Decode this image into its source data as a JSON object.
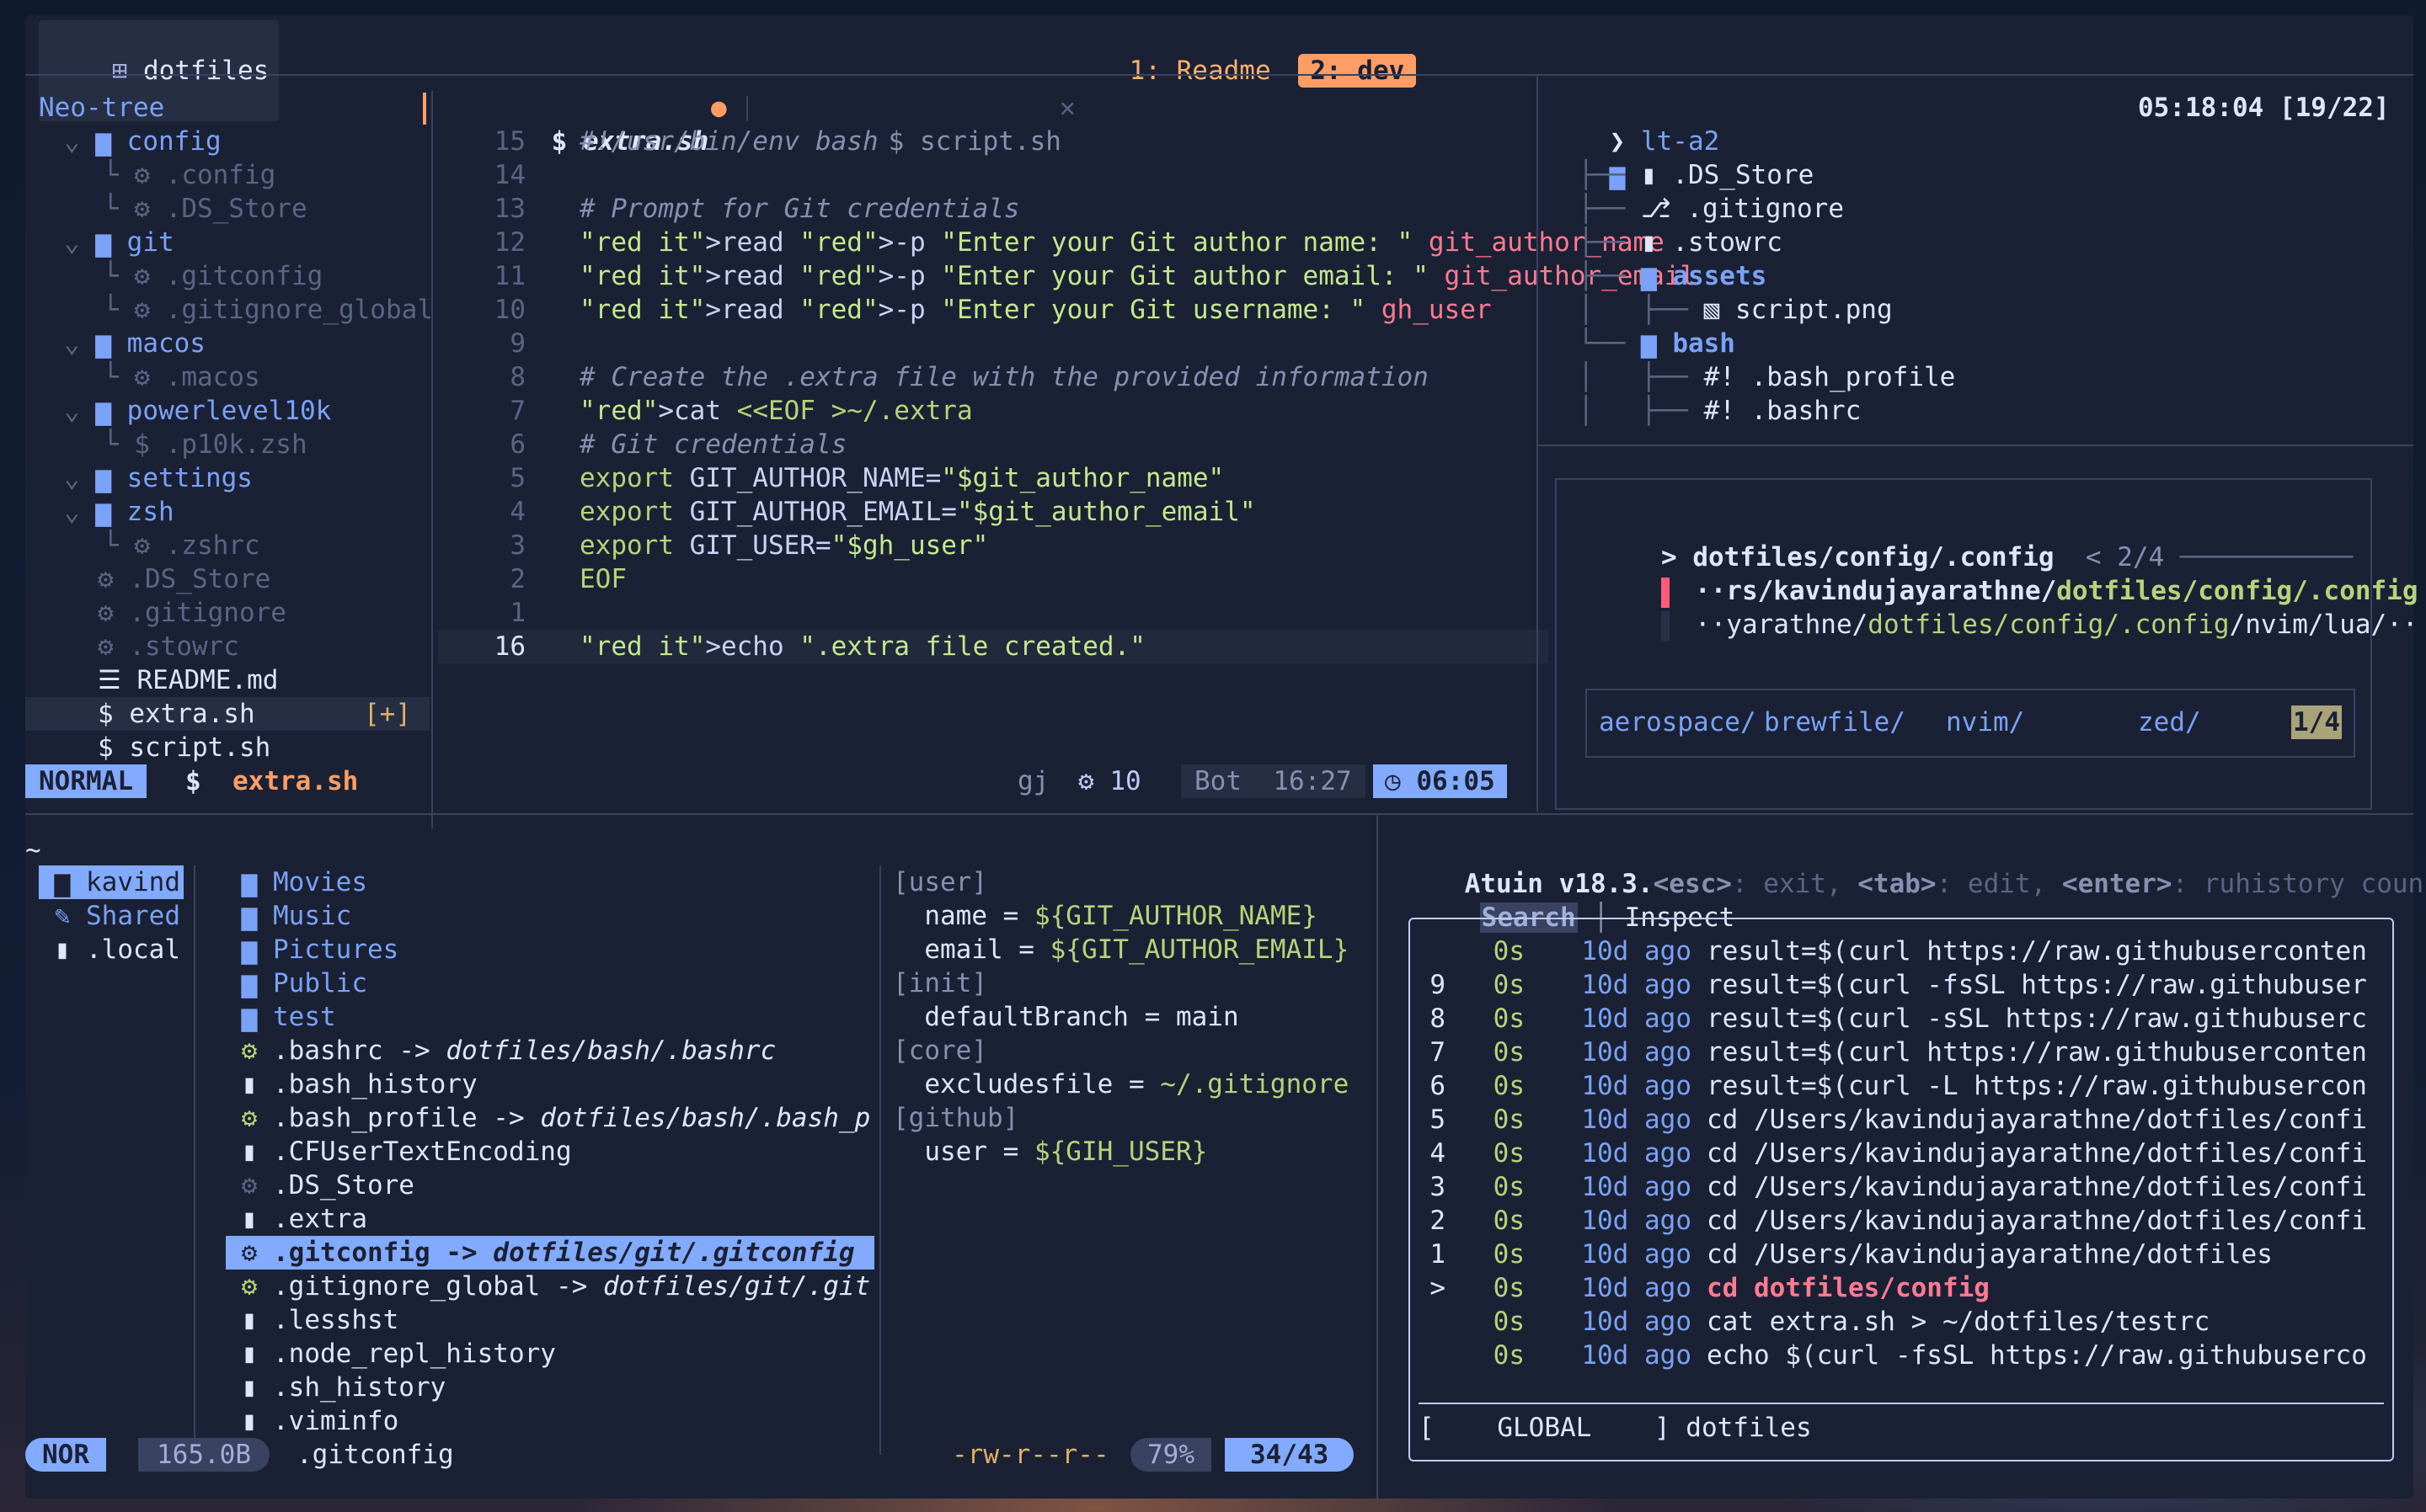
{
  "tmux": {
    "session": "dotfiles",
    "windows": [
      "1: Readme",
      "2: dev"
    ]
  },
  "neotree": {
    "title": "Neo-tree",
    "items": [
      {
        "t": "config",
        "k": "dir",
        "d": 0
      },
      {
        "t": ".config",
        "k": "dim",
        "d": 1
      },
      {
        "t": ".DS_Store",
        "k": "dim",
        "d": 1
      },
      {
        "t": "git",
        "k": "dir",
        "d": 0
      },
      {
        "t": ".gitconfig",
        "k": "dim",
        "d": 1
      },
      {
        "t": ".gitignore_global",
        "k": "dim",
        "d": 1
      },
      {
        "t": "macos",
        "k": "dir",
        "d": 0
      },
      {
        "t": ".macos",
        "k": "dim",
        "d": 1
      },
      {
        "t": "powerlevel10k",
        "k": "dir",
        "d": 0
      },
      {
        "t": ".p10k.zsh",
        "k": "dim",
        "d": 1
      },
      {
        "t": "settings",
        "k": "dir",
        "d": 0
      },
      {
        "t": "zsh",
        "k": "dir",
        "d": 0
      },
      {
        "t": ".zshrc",
        "k": "dim",
        "d": 1
      },
      {
        "t": ".DS_Store",
        "k": "dim",
        "d": 0
      },
      {
        "t": ".gitignore",
        "k": "dim",
        "d": 0
      },
      {
        "t": ".stowrc",
        "k": "dim",
        "d": 0
      },
      {
        "t": "README.md",
        "k": "file",
        "d": 0
      },
      {
        "t": "extra.sh",
        "k": "file",
        "d": 0,
        "mark": "[+]"
      },
      {
        "t": "script.sh",
        "k": "file",
        "d": 0
      }
    ]
  },
  "editor": {
    "tabs": [
      {
        "name": "extra.sh",
        "active": true,
        "mark": "●"
      },
      {
        "name": "script.sh",
        "active": false,
        "mark": "✕"
      }
    ],
    "lines": [
      {
        "n": "15",
        "code": "#!/usr/bin/env bash"
      },
      {
        "n": "14",
        "code": ""
      },
      {
        "n": "13",
        "code": "# Prompt for Git credentials"
      },
      {
        "n": "12",
        "code": "read -p \"Enter your Git author name: \" git_author_name"
      },
      {
        "n": "11",
        "code": "read -p \"Enter your Git author email: \" git_author_email"
      },
      {
        "n": "10",
        "code": "read -p \"Enter your Git username: \" gh_user"
      },
      {
        "n": "9",
        "code": ""
      },
      {
        "n": "8",
        "code": "# Create the .extra file with the provided information"
      },
      {
        "n": "7",
        "code": "cat <<EOF >~/.extra"
      },
      {
        "n": "6",
        "code": "# Git credentials"
      },
      {
        "n": "5",
        "code": "export GIT_AUTHOR_NAME=\"$git_author_name\""
      },
      {
        "n": "4",
        "code": "export GIT_AUTHOR_EMAIL=\"$git_author_email\""
      },
      {
        "n": "3",
        "code": "export GIT_USER=\"$gh_user\""
      },
      {
        "n": "2",
        "code": "EOF"
      },
      {
        "n": "1",
        "code": ""
      },
      {
        "n": "16",
        "code": "echo \".extra file created.\""
      }
    ],
    "status": {
      "mode": "NORMAL",
      "file": "extra.sh",
      "keys": "gj",
      "diag": "10",
      "pos": "Bot",
      "cursor": "16:27",
      "clock": "06:05"
    }
  },
  "broot": {
    "prompt": "lt-a2",
    "time": "05:18:04 [19/22]",
    "root": ".",
    "items": [
      {
        "t": ".DS_Store",
        "d": 1
      },
      {
        "t": ".gitignore",
        "d": 1
      },
      {
        "t": ".stowrc",
        "d": 1
      },
      {
        "t": "assets",
        "d": 1,
        "dir": true
      },
      {
        "t": "script.png",
        "d": 2
      },
      {
        "t": "bash",
        "d": 1,
        "dir": true
      },
      {
        "t": ".bash_profile",
        "d": 2
      },
      {
        "t": ".bashrc",
        "d": 2
      }
    ]
  },
  "zoxide": {
    "query": "dotfiles/config/.config",
    "count": "< 2/4",
    "results": [
      {
        "a": "··rs/kavindujayarathne/",
        "b": "dotfiles/config/.config",
        "c": ""
      },
      {
        "a": "··yarathne/",
        "b": "dotfiles/config/.config",
        "c": "/nvim/lua/··"
      }
    ],
    "dirs": [
      "aerospace/",
      "brewfile/",
      "nvim/",
      "zed/"
    ],
    "page": "1/4"
  },
  "yazi": {
    "cwd": "~",
    "parent": [
      "kavind",
      "Shared",
      ".local"
    ],
    "current": [
      {
        "t": "Movies",
        "k": "dir"
      },
      {
        "t": "Music",
        "k": "dir"
      },
      {
        "t": "Pictures",
        "k": "dir"
      },
      {
        "t": "Public",
        "k": "dir"
      },
      {
        "t": "test",
        "k": "dir"
      },
      {
        "t": ".bashrc",
        "link": "dotfiles/bash/.bashrc",
        "k": "link"
      },
      {
        "t": ".bash_history",
        "k": "file"
      },
      {
        "t": ".bash_profile",
        "link": "dotfiles/bash/.bash_p",
        "k": "link"
      },
      {
        "t": ".CFUserTextEncoding",
        "k": "file"
      },
      {
        "t": ".DS_Store",
        "k": "file"
      },
      {
        "t": ".extra",
        "k": "file"
      },
      {
        "t": ".gitconfig",
        "link": "dotfiles/git/.gitconfig",
        "k": "sel"
      },
      {
        "t": ".gitignore_global",
        "link": "dotfiles/git/.git",
        "k": "link"
      },
      {
        "t": ".lesshst",
        "k": "file"
      },
      {
        "t": ".node_repl_history",
        "k": "file"
      },
      {
        "t": ".sh_history",
        "k": "file"
      },
      {
        "t": ".viminfo",
        "k": "file"
      }
    ],
    "preview": [
      {
        "s": "[user]",
        "k": "sec"
      },
      {
        "key": "name",
        "val": "${GIT_AUTHOR_NAME}"
      },
      {
        "key": "email",
        "val": "${GIT_AUTHOR_EMAIL}"
      },
      {
        "s": "[init]",
        "k": "sec"
      },
      {
        "key": "defaultBranch",
        "val": "main",
        "plain": true
      },
      {
        "s": "[core]",
        "k": "sec"
      },
      {
        "key": "excludesfile",
        "val": "~/.gitignore"
      },
      {
        "s": "[github]",
        "k": "sec"
      },
      {
        "key": "user",
        "val": "${GIH_USER}"
      }
    ],
    "status": {
      "mode": "NOR",
      "size": "165.0B",
      "name": ".gitconfig",
      "perm": "-rw-r--r--",
      "pct": "79%",
      "pos": "34/43"
    }
  },
  "atuin": {
    "title": "Atuin v18.3.",
    "help": [
      {
        "k": "<esc>",
        "v": ": exit, "
      },
      {
        "k": "<tab>",
        "v": ": edit, "
      },
      {
        "k": "<enter>",
        "v": ": ruhistory coun"
      }
    ],
    "tabs": [
      "Search",
      "Inspect"
    ],
    "rows": [
      {
        "i": "",
        "d": "0s",
        "a": "10d ago",
        "c": "result=$(curl https://raw.githubuserconten"
      },
      {
        "i": "9",
        "d": "0s",
        "a": "10d ago",
        "c": "result=$(curl -fsSL https://raw.githubuser"
      },
      {
        "i": "8",
        "d": "0s",
        "a": "10d ago",
        "c": "result=$(curl -sSL https://raw.githubuserc"
      },
      {
        "i": "7",
        "d": "0s",
        "a": "10d ago",
        "c": "result=$(curl https://raw.githubuserconten"
      },
      {
        "i": "6",
        "d": "0s",
        "a": "10d ago",
        "c": "result=$(curl -L https://raw.githubusercon"
      },
      {
        "i": "5",
        "d": "0s",
        "a": "10d ago",
        "c": "cd /Users/kavindujayarathne/dotfiles/confi"
      },
      {
        "i": "4",
        "d": "0s",
        "a": "10d ago",
        "c": "cd /Users/kavindujayarathne/dotfiles/confi"
      },
      {
        "i": "3",
        "d": "0s",
        "a": "10d ago",
        "c": "cd /Users/kavindujayarathne/dotfiles/confi"
      },
      {
        "i": "2",
        "d": "0s",
        "a": "10d ago",
        "c": "cd /Users/kavindujayarathne/dotfiles/confi"
      },
      {
        "i": "1",
        "d": "0s",
        "a": "10d ago",
        "c": "cd /Users/kavindujayarathne/dotfiles"
      },
      {
        "i": ">",
        "d": "0s",
        "a": "10d ago",
        "c": "cd dotfiles/config",
        "sel": true
      },
      {
        "i": "",
        "d": "0s",
        "a": "10d ago",
        "c": "cat extra.sh > ~/dotfiles/testrc"
      },
      {
        "i": "",
        "d": "0s",
        "a": "10d ago",
        "c": "echo $(curl -fsSL https://raw.githubuserco"
      }
    ],
    "filter": "GLOBAL",
    "context": "dotfiles"
  },
  "colors": {
    "accent": "#ff9e64",
    "blue": "#7aa2f7",
    "green": "#b7d37a",
    "red": "#ff7a93",
    "bg": "#1b2134"
  }
}
